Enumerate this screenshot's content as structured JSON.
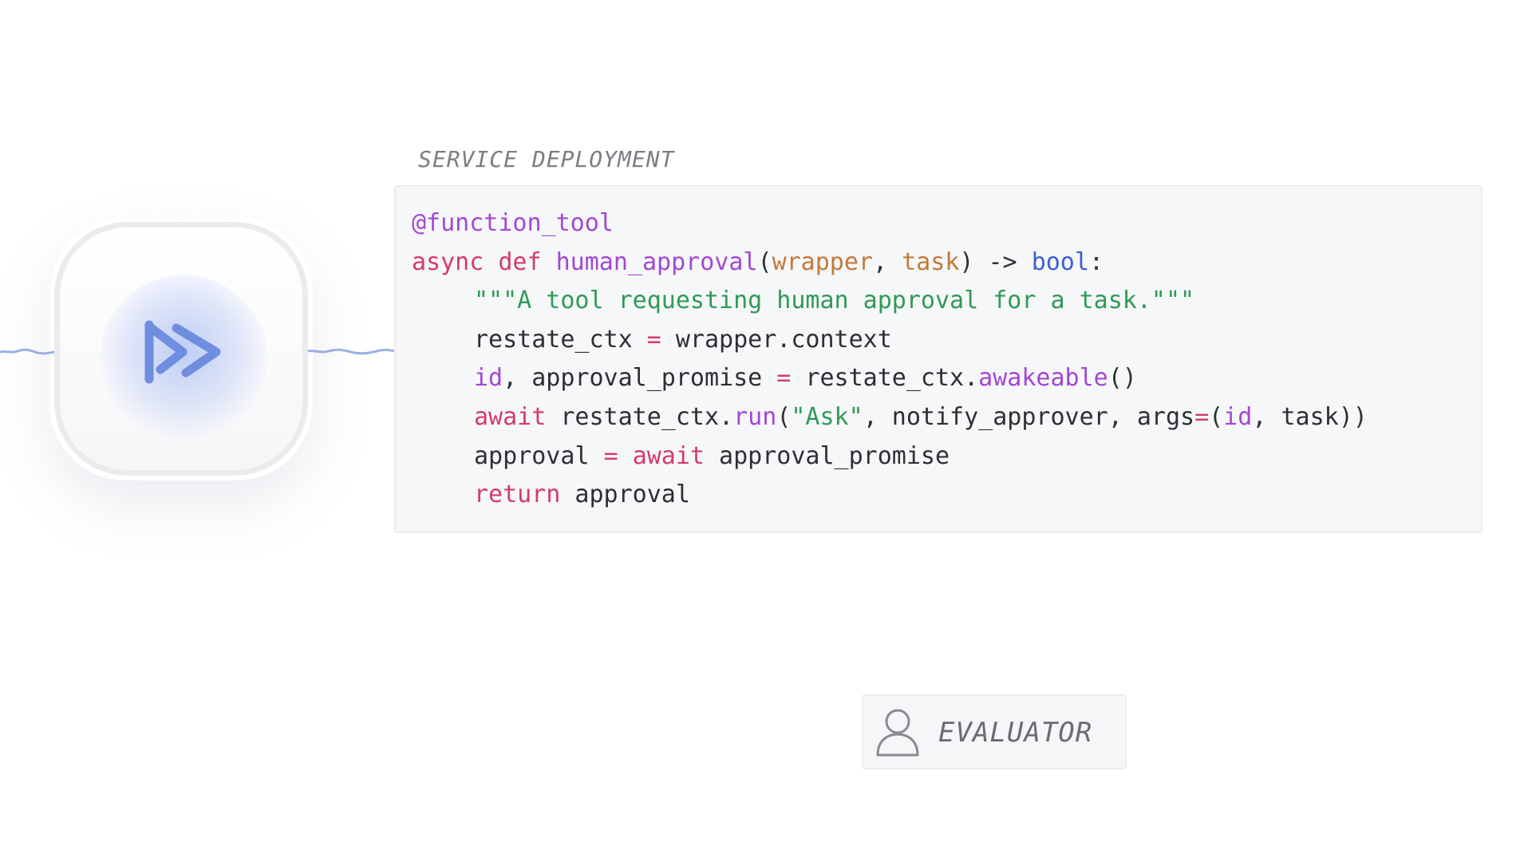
{
  "logo": {
    "icon": "double-forward-arrow-icon",
    "accent_color": "#6f8ee0"
  },
  "service_section": {
    "label": "SERVICE DEPLOYMENT"
  },
  "code": {
    "language": "python",
    "lines": [
      [
        {
          "t": "@function_tool",
          "k": "decorator"
        }
      ],
      [
        {
          "t": "async",
          "k": "keyword"
        },
        {
          "t": " ",
          "k": "plain"
        },
        {
          "t": "def",
          "k": "keyword"
        },
        {
          "t": " ",
          "k": "plain"
        },
        {
          "t": "human_approval",
          "k": "funcname"
        },
        {
          "t": "(",
          "k": "plain"
        },
        {
          "t": "wrapper",
          "k": "param"
        },
        {
          "t": ", ",
          "k": "plain"
        },
        {
          "t": "task",
          "k": "param"
        },
        {
          "t": ") -> ",
          "k": "plain"
        },
        {
          "t": "bool",
          "k": "type"
        },
        {
          "t": ":",
          "k": "plain"
        }
      ],
      [
        {
          "t": "\"\"\"A tool requesting human approval for a task.\"\"\"",
          "k": "string",
          "indent": true
        }
      ],
      [
        {
          "t": "restate_ctx ",
          "k": "plain",
          "indent": true
        },
        {
          "t": "=",
          "k": "op"
        },
        {
          "t": " wrapper.context",
          "k": "plain"
        }
      ],
      [
        {
          "t": "id",
          "k": "var",
          "indent": true
        },
        {
          "t": ", approval_promise ",
          "k": "plain"
        },
        {
          "t": "=",
          "k": "op"
        },
        {
          "t": " restate_ctx.",
          "k": "plain"
        },
        {
          "t": "awakeable",
          "k": "method"
        },
        {
          "t": "()",
          "k": "plain"
        }
      ],
      [
        {
          "t": "await",
          "k": "keyword",
          "indent": true
        },
        {
          "t": " restate_ctx.",
          "k": "plain"
        },
        {
          "t": "run",
          "k": "method"
        },
        {
          "t": "(",
          "k": "plain"
        },
        {
          "t": "\"Ask\"",
          "k": "string"
        },
        {
          "t": ", notify_approver, args",
          "k": "plain"
        },
        {
          "t": "=",
          "k": "op"
        },
        {
          "t": "(",
          "k": "plain"
        },
        {
          "t": "id",
          "k": "var"
        },
        {
          "t": ", task))",
          "k": "plain"
        }
      ],
      [
        {
          "t": "approval ",
          "k": "plain",
          "indent": true
        },
        {
          "t": "=",
          "k": "op"
        },
        {
          "t": " ",
          "k": "plain"
        },
        {
          "t": "await",
          "k": "keyword"
        },
        {
          "t": " approval_promise",
          "k": "plain"
        }
      ],
      [
        {
          "t": "return",
          "k": "keyword",
          "indent": true
        },
        {
          "t": " approval",
          "k": "plain"
        }
      ]
    ]
  },
  "evaluator": {
    "label": "EVALUATOR",
    "icon": "user-icon"
  }
}
